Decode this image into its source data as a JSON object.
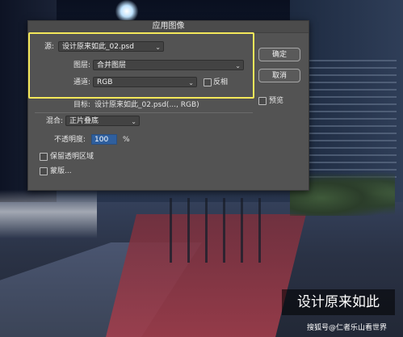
{
  "dialog": {
    "title": "应用图像",
    "source": {
      "label": "源:",
      "value": "设计原来如此_02.psd"
    },
    "layer": {
      "label": "图层:",
      "value": "合并图层"
    },
    "channel": {
      "label": "通道:",
      "value": "RGB",
      "invert_label": "反相",
      "invert_checked": false
    },
    "target": {
      "label": "目标:",
      "value": "设计原来如此_02.psd(..., RGB)"
    },
    "blending": {
      "label": "混合:",
      "value": "正片叠底"
    },
    "opacity": {
      "label": "不透明度:",
      "value": "100",
      "unit": "%"
    },
    "preserve_transparency": {
      "label": "保留透明区域",
      "checked": false
    },
    "mask": {
      "label": "蒙版...",
      "checked": false
    },
    "buttons": {
      "ok": "确定",
      "cancel": "取消"
    },
    "preview": {
      "label": "预览",
      "checked": false
    }
  },
  "overlay": {
    "title": "设计原来如此",
    "credit": "搜狐号@仁者乐山看世界"
  },
  "colors": {
    "dialog_bg": "#535353",
    "highlight": "#f4e85a",
    "opacity_input": "#2f5f9e"
  }
}
